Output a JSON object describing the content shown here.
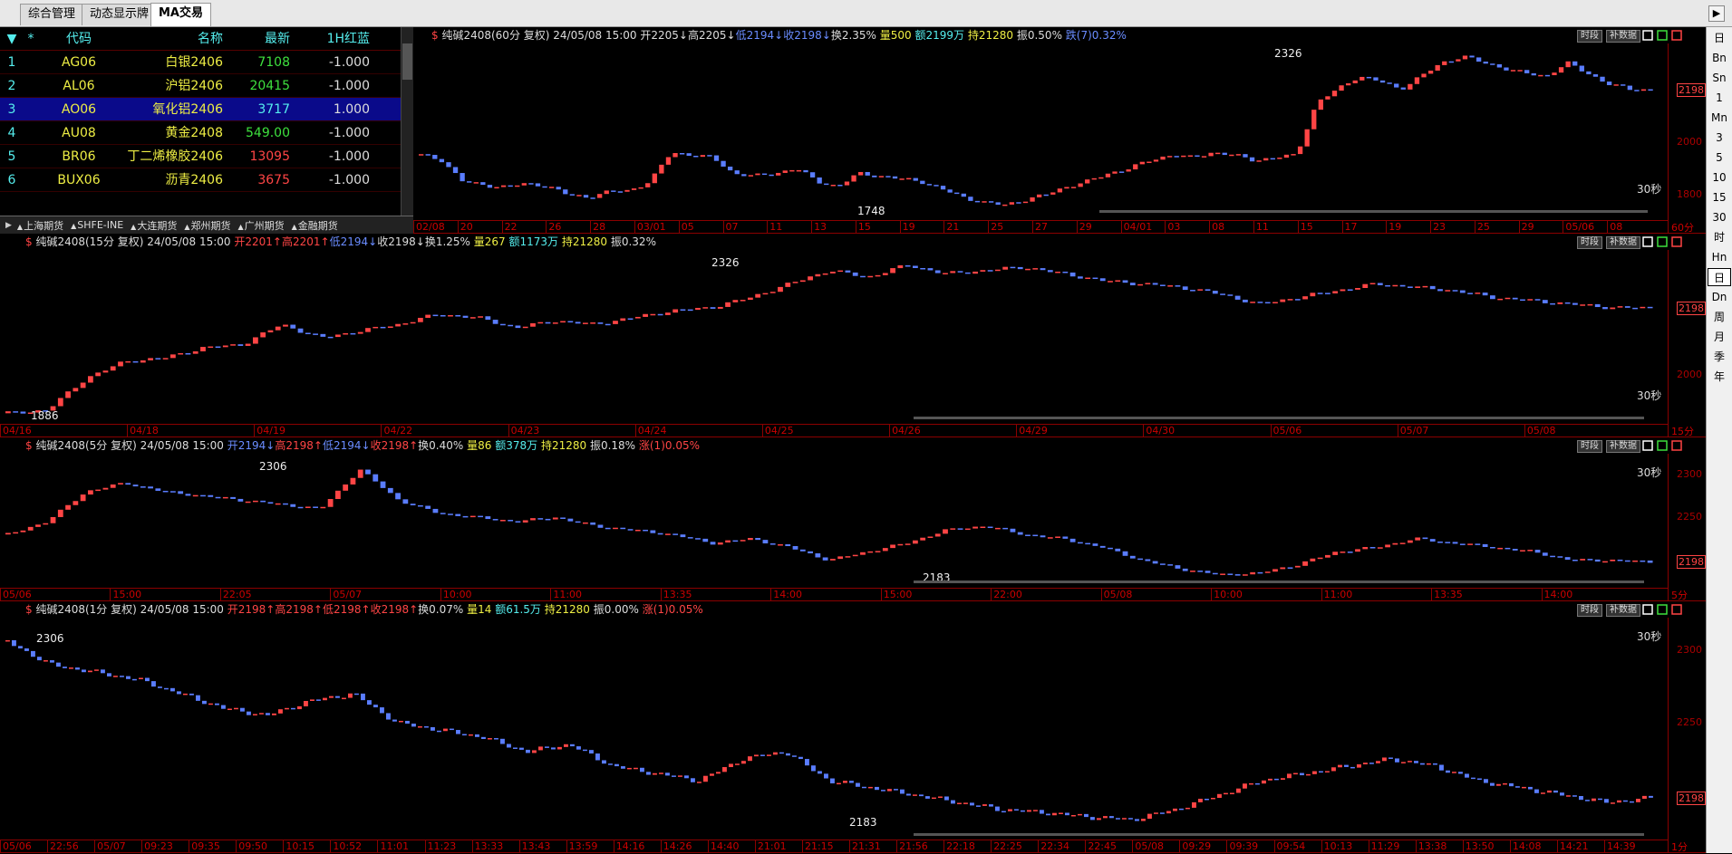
{
  "tabs": [
    {
      "label": "综合管理"
    },
    {
      "label": "动态显示牌"
    },
    {
      "label": "MA交易"
    }
  ],
  "right_toolbar": [
    "日",
    "Bn",
    "Sn",
    "1",
    "Mn",
    "3",
    "5",
    "10",
    "15",
    "30",
    "时",
    "Hn",
    "日",
    "Dn",
    "周",
    "月",
    "季",
    "年"
  ],
  "quote_table": {
    "headers": [
      "▼",
      "*",
      "代码",
      "名称",
      "最新",
      "1H红蓝"
    ],
    "rows": [
      {
        "idx": "1",
        "code": "AG06",
        "name": "白银2406",
        "price": "7108",
        "ind": "-1.000",
        "color": "#3ee03e"
      },
      {
        "idx": "2",
        "code": "AL06",
        "name": "沪铝2406",
        "price": "20415",
        "ind": "-1.000",
        "color": "#3ee03e"
      },
      {
        "idx": "3",
        "code": "AO06",
        "name": "氧化铝2406",
        "price": "3717",
        "ind": "1.000",
        "color": "#5ee"
      },
      {
        "idx": "4",
        "code": "AU08",
        "name": "黄金2408",
        "price": "549.00",
        "ind": "-1.000",
        "color": "#3ee03e"
      },
      {
        "idx": "5",
        "code": "BR06",
        "name": "丁二烯橡胶2406",
        "price": "13095",
        "ind": "-1.000",
        "color": "#ff4545"
      },
      {
        "idx": "6",
        "code": "BUX06",
        "name": "沥青2406",
        "price": "3675",
        "ind": "-1.000",
        "color": "#ff4545"
      }
    ]
  },
  "market_tabs": [
    "上海期货",
    "SHFE-INE",
    "大连期货",
    "郑州期货",
    "广州期货",
    "金融期货"
  ],
  "panels": [
    {
      "head": [
        {
          "t": "纯碱2408(60分 复权) 24/05/08 15:00 ",
          "c": "#ddd"
        },
        {
          "t": "开2205↓",
          "c": "#ddd"
        },
        {
          "t": "高2205↓",
          "c": "#ddd"
        },
        {
          "t": "低2194↓",
          "c": "#6a8cff"
        },
        {
          "t": "收2198↓",
          "c": "#6a8cff"
        },
        {
          "t": "换2.35% ",
          "c": "#ddd"
        },
        {
          "t": "量500 ",
          "c": "#ee4"
        },
        {
          "t": "额2199万 ",
          "c": "#5ee"
        },
        {
          "t": "持21280 ",
          "c": "#ee4"
        },
        {
          "t": "振0.50% ",
          "c": "#ddd"
        },
        {
          "t": "跌(7)0.32%",
          "c": "#6a8cff"
        }
      ],
      "yticks": [
        "2000",
        "1800"
      ],
      "last": "2198",
      "high_label": "2326",
      "low_label": "1748",
      "sec": "30秒",
      "tf": "60分",
      "xticks": [
        "02/08",
        "20",
        "22",
        "26",
        "28",
        "03/01",
        "05",
        "07",
        "11",
        "13",
        "15",
        "19",
        "21",
        "25",
        "27",
        "29",
        "04/01",
        "03",
        "08",
        "11",
        "15",
        "17",
        "19",
        "23",
        "25",
        "29",
        "05/06",
        "08"
      ]
    },
    {
      "head": [
        {
          "t": "纯碱2408(15分 复权) 24/05/08 15:00 ",
          "c": "#ddd"
        },
        {
          "t": "开2201↑",
          "c": "#ff4545"
        },
        {
          "t": "高2201↑",
          "c": "#ff4545"
        },
        {
          "t": "低2194↓",
          "c": "#6a8cff"
        },
        {
          "t": "收2198↓",
          "c": "#ddd"
        },
        {
          "t": "换1.25% ",
          "c": "#ddd"
        },
        {
          "t": "量267 ",
          "c": "#ee4"
        },
        {
          "t": "额1173万 ",
          "c": "#5ee"
        },
        {
          "t": "持21280 ",
          "c": "#ee4"
        },
        {
          "t": "振0.32%",
          "c": "#ddd"
        }
      ],
      "yticks": [
        "2000"
      ],
      "last": "2198",
      "high_label": "2326",
      "low_label": "1886",
      "sec": "30秒",
      "tf": "15分",
      "xticks": [
        "04/16",
        "04/18",
        "04/19",
        "04/22",
        "04/23",
        "04/24",
        "04/25",
        "04/26",
        "04/29",
        "04/30",
        "05/06",
        "05/07",
        "05/08"
      ]
    },
    {
      "head": [
        {
          "t": "纯碱2408(5分 复权) 24/05/08 15:00 ",
          "c": "#ddd"
        },
        {
          "t": "开2194↓",
          "c": "#6a8cff"
        },
        {
          "t": "高2198↑",
          "c": "#ff4545"
        },
        {
          "t": "低2194↓",
          "c": "#6a8cff"
        },
        {
          "t": "收2198↑",
          "c": "#ff4545"
        },
        {
          "t": "换0.40% ",
          "c": "#ddd"
        },
        {
          "t": "量86 ",
          "c": "#ee4"
        },
        {
          "t": "额378万 ",
          "c": "#5ee"
        },
        {
          "t": "持21280 ",
          "c": "#ee4"
        },
        {
          "t": "振0.18% ",
          "c": "#ddd"
        },
        {
          "t": "涨(1)0.05%",
          "c": "#ff4545"
        }
      ],
      "yticks": [
        "2300",
        "2250"
      ],
      "last": "2198",
      "high_label": "2306",
      "low_label": "2183",
      "sec": "30秒",
      "tf": "5分",
      "xticks": [
        "05/06",
        "15:00",
        "22:05",
        "05/07",
        "10:00",
        "11:00",
        "13:35",
        "14:00",
        "15:00",
        "22:00",
        "05/08",
        "10:00",
        "11:00",
        "13:35",
        "14:00"
      ]
    },
    {
      "head": [
        {
          "t": "纯碱2408(1分 复权) 24/05/08 15:00 ",
          "c": "#ddd"
        },
        {
          "t": "开2198↑",
          "c": "#ff4545"
        },
        {
          "t": "高2198↑",
          "c": "#ff4545"
        },
        {
          "t": "低2198↑",
          "c": "#ff4545"
        },
        {
          "t": "收2198↑",
          "c": "#ff4545"
        },
        {
          "t": "换0.07% ",
          "c": "#ddd"
        },
        {
          "t": "量14 ",
          "c": "#ee4"
        },
        {
          "t": "额61.5万 ",
          "c": "#5ee"
        },
        {
          "t": "持21280 ",
          "c": "#ee4"
        },
        {
          "t": "振0.00% ",
          "c": "#ddd"
        },
        {
          "t": "涨(1)0.05%",
          "c": "#ff4545"
        }
      ],
      "yticks": [
        "2300",
        "2250"
      ],
      "last": "2198",
      "high_label": "2306",
      "low_label": "2183",
      "sec": "30秒",
      "tf": "1分",
      "xticks": [
        "05/06",
        "22:56",
        "05/07",
        "09:23",
        "09:35",
        "09:50",
        "10:15",
        "10:52",
        "11:01",
        "11:23",
        "13:33",
        "13:43",
        "13:59",
        "14:16",
        "14:26",
        "14:40",
        "21:01",
        "21:15",
        "21:31",
        "21:56",
        "22:18",
        "22:25",
        "22:34",
        "22:45",
        "05/08",
        "09:29",
        "09:39",
        "09:54",
        "10:13",
        "11:29",
        "13:38",
        "13:50",
        "14:08",
        "14:21",
        "14:39"
      ]
    }
  ],
  "panel_buttons": {
    "time": "时段",
    "supp": "补数据"
  },
  "colors": {
    "up": "#ff4545",
    "down": "#5a7dff",
    "axis": "#8b0000"
  }
}
